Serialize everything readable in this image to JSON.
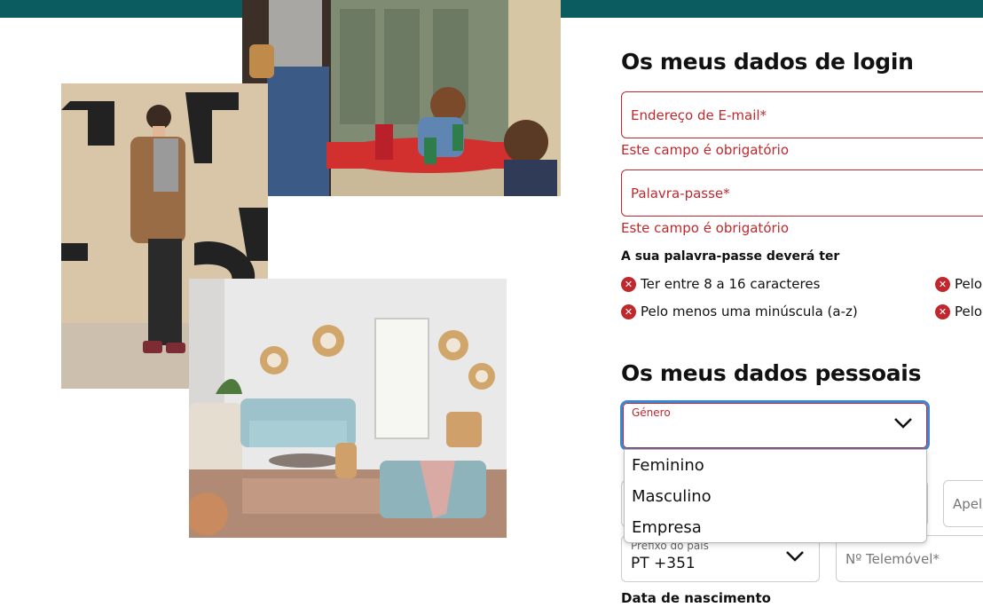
{
  "login": {
    "title": "Os meus dados de login",
    "email_placeholder": "Endereço de E-mail*",
    "email_error": "Este campo é obrigatório",
    "password_placeholder": "Palavra-passe*",
    "password_error": "Este campo é obrigatório",
    "rules_title": "A sua palavra-passe deverá ter",
    "rules": [
      {
        "text": "Ter entre 8 a 16 caracteres"
      },
      {
        "text": "Pelo menos uma minúscula (a-z)"
      },
      {
        "text": "Pelo"
      },
      {
        "text": "Pelo"
      }
    ]
  },
  "personal": {
    "title": "Os meus dados pessoais",
    "gender_label": "Género",
    "gender_options": [
      "Feminino",
      "Masculino",
      "Empresa"
    ],
    "lastname_placeholder": "Apel",
    "prefix_label": "Prefixo do país",
    "prefix_value": "PT +351",
    "phone_placeholder": "Nº Telemóvel*",
    "dob_label": "Data de nascimento"
  },
  "colors": {
    "topbar": "#0a5c61",
    "error": "#c0282d",
    "focus": "#3a86d8"
  },
  "icons": {
    "error": "x-circle-icon",
    "dropdown": "chevron-down-icon"
  }
}
